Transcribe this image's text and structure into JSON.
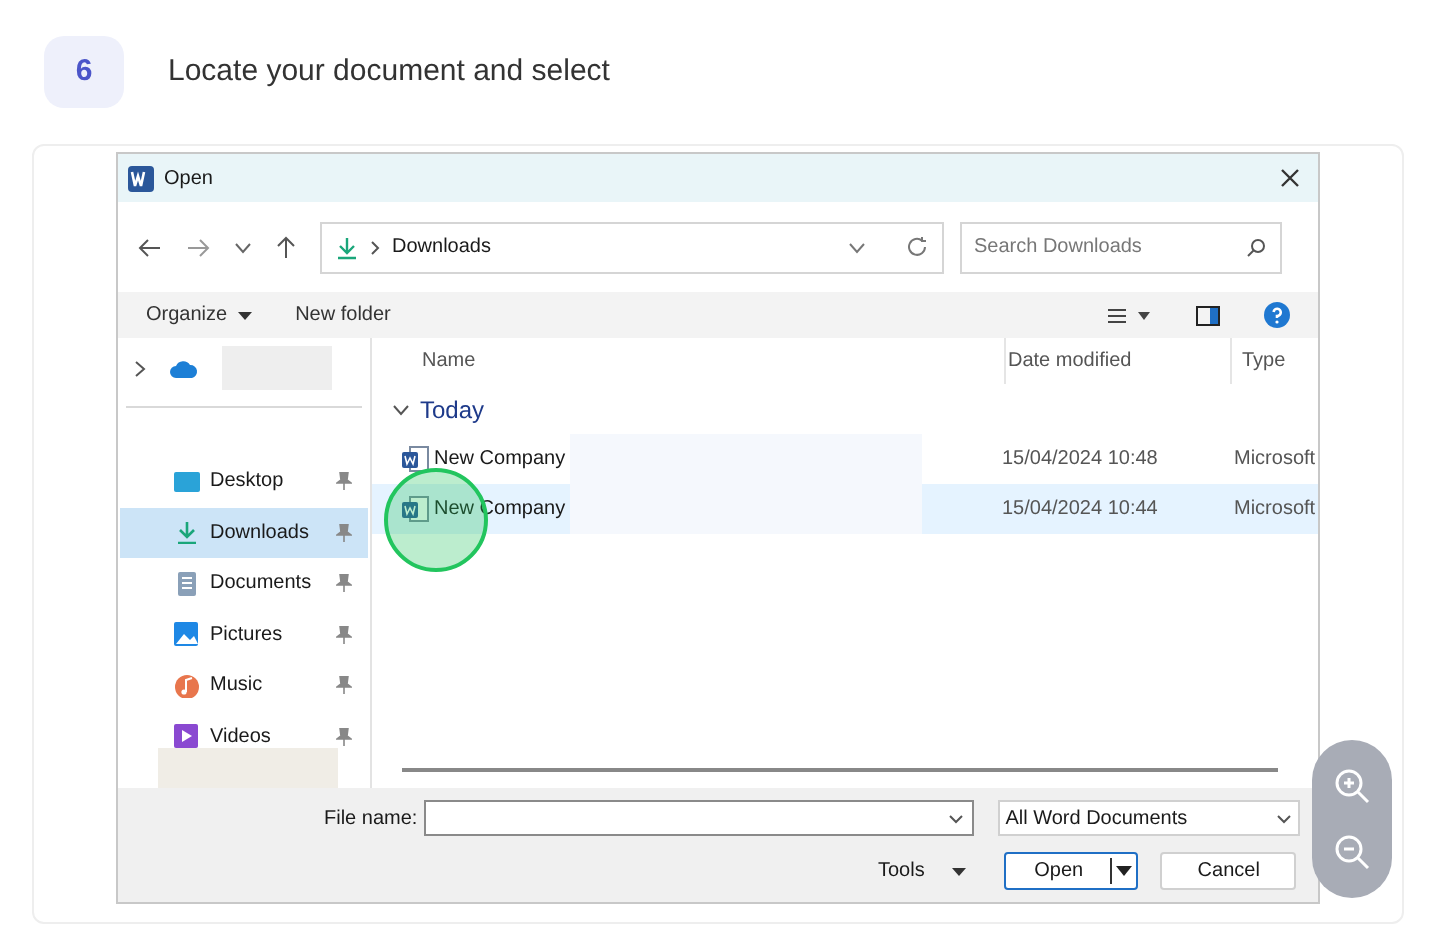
{
  "step": {
    "number": "6",
    "title": "Locate your document and select"
  },
  "dialog": {
    "title": "Open",
    "breadcrumb": "Downloads",
    "search_placeholder": "Search Downloads",
    "toolbar": [
      "Organize",
      "New folder"
    ],
    "sidebar": [
      {
        "kind": "desktop",
        "label": "Desktop",
        "selected": false
      },
      {
        "kind": "downloads",
        "label": "Downloads",
        "selected": true
      },
      {
        "kind": "documents",
        "label": "Documents",
        "selected": false
      },
      {
        "kind": "pictures",
        "label": "Pictures",
        "selected": false
      },
      {
        "kind": "music",
        "label": "Music",
        "selected": false
      },
      {
        "kind": "videos",
        "label": "Videos",
        "selected": false
      }
    ],
    "columns": [
      "Name",
      "Date modified",
      "Type"
    ],
    "group": "Today",
    "files": [
      {
        "name": "New Company",
        "date": "15/04/2024 10:48",
        "type": "Microsoft",
        "selected": false
      },
      {
        "name": "New Company",
        "date": "15/04/2024 10:44",
        "type": "Microsoft",
        "selected": true
      }
    ],
    "file_name_label": "File name:",
    "file_type": "All Word Documents",
    "tools": "Tools",
    "open": "Open",
    "cancel": "Cancel"
  }
}
